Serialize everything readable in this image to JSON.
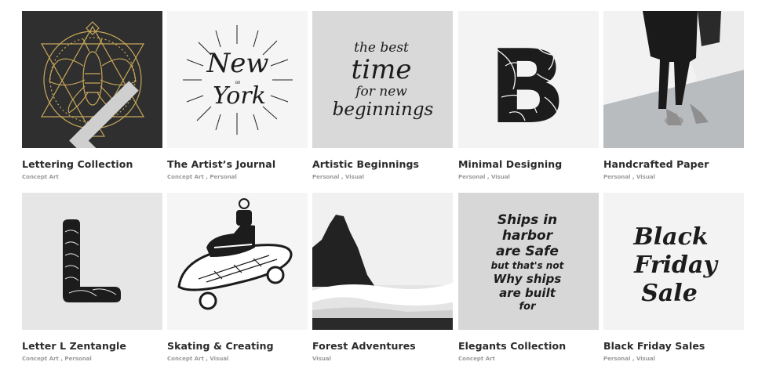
{
  "portfolio": {
    "items": [
      {
        "title": "Lettering Collection",
        "categories": [
          "Concept Art"
        ]
      },
      {
        "title": "The Artist’s Journal",
        "categories": [
          "Concept Art",
          "Personal"
        ]
      },
      {
        "title": "Artistic Beginnings",
        "categories": [
          "Personal",
          "Visual"
        ]
      },
      {
        "title": "Minimal Designing",
        "categories": [
          "Personal",
          "Visual"
        ]
      },
      {
        "title": "Handcrafted Paper",
        "categories": [
          "Personal",
          "Visual"
        ]
      },
      {
        "title": "Letter L Zentangle",
        "categories": [
          "Concept Art",
          "Personal"
        ]
      },
      {
        "title": "Skating & Creating",
        "categories": [
          "Concept Art",
          "Visual"
        ]
      },
      {
        "title": "Forest Adventures",
        "categories": [
          "Visual"
        ]
      },
      {
        "title": "Elegants Collection",
        "categories": [
          "Concept Art"
        ]
      },
      {
        "title": "Black Friday Sales",
        "categories": [
          "Personal",
          "Visual"
        ]
      }
    ],
    "separator": " , "
  },
  "artwork_text": {
    "new_york": {
      "line1": "New",
      "small": "on",
      "line2": "York"
    },
    "best_time": {
      "l1": "the best",
      "l2": "time",
      "l3": "for new",
      "l4": "beginnings"
    },
    "minimal_letter": "B",
    "zentangle_letter": "L",
    "ships": {
      "l1": "Ships in",
      "l2": "harbor",
      "l3": "are Safe",
      "l4": "but that's not",
      "l5": "Why ships",
      "l6": "are built",
      "l7": "for"
    },
    "black_friday": {
      "l1": "Black",
      "l2": "Friday",
      "l3": "Sale"
    }
  },
  "colors": {
    "gold": "#c8a85a",
    "dark_tile": "#2f2f2f",
    "light_tile": "#f4f4f4",
    "grey_tile": "#d9d9d9",
    "ink": "#1c1c1c"
  }
}
